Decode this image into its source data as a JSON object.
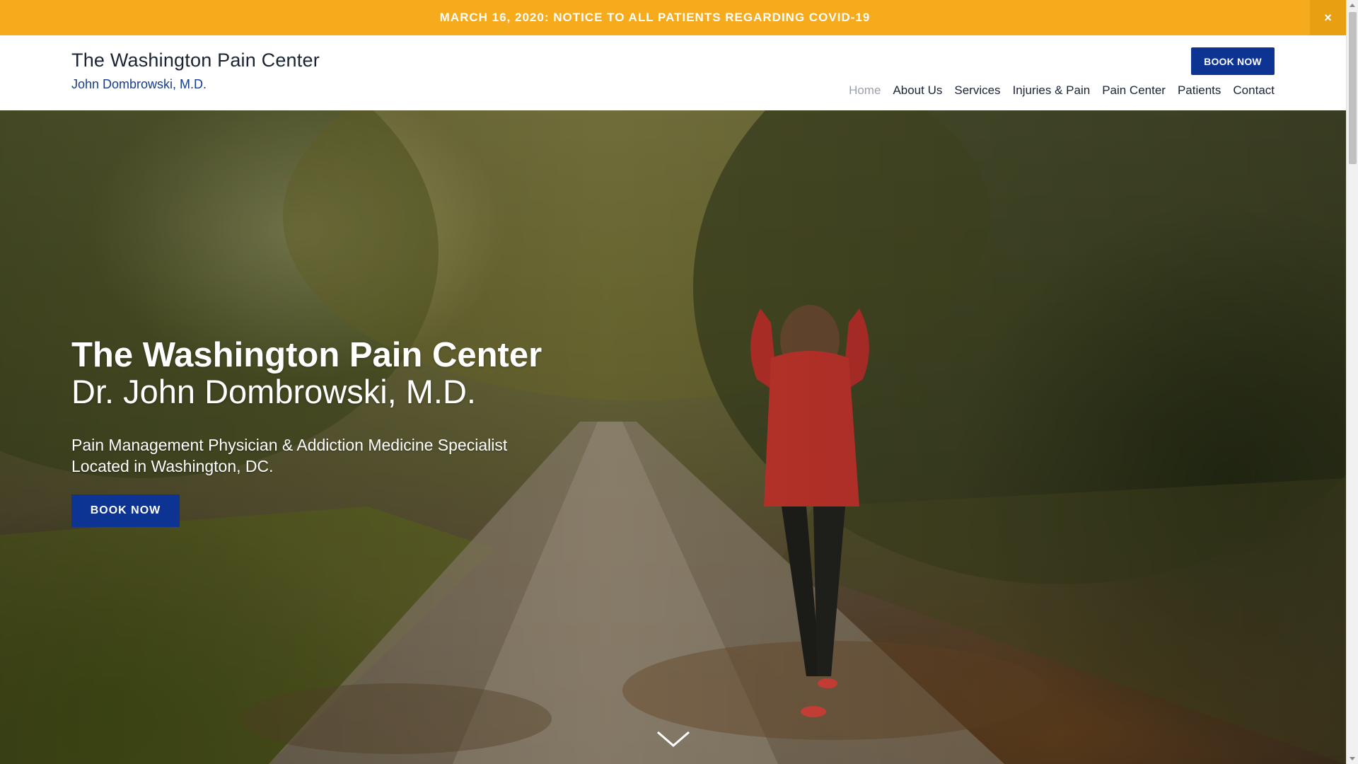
{
  "notice_bar": {
    "text": "MARCH 16, 2020: NOTICE TO ALL PATIENTS REGARDING COVID-19",
    "close_label": "×",
    "background_color": "#f5ab1c"
  },
  "header": {
    "title": "The Washington Pain Center",
    "subtitle": "John Dombrowski, M.D.",
    "book_label": "BOOK NOW",
    "nav": [
      {
        "label": "Home",
        "active": true
      },
      {
        "label": "About Us",
        "active": false
      },
      {
        "label": "Services",
        "active": false
      },
      {
        "label": "Injuries & Pain",
        "active": false
      },
      {
        "label": "Pain Center",
        "active": false
      },
      {
        "label": "Patients",
        "active": false
      },
      {
        "label": "Contact",
        "active": false
      }
    ]
  },
  "hero": {
    "heading": "The Washington Pain Center",
    "doctor": "Dr. John Dombrowski, M.D.",
    "desc_line1": "Pain Management Physician & Addiction Medicine Specialist",
    "desc_line2": "Located in Washington, DC.",
    "book_label": "BOOK NOW",
    "scroll_icon": "chevron-down-icon"
  },
  "colors": {
    "accent": "#0d3393",
    "notice": "#f5ab1c",
    "subtitle": "#163d8c"
  }
}
